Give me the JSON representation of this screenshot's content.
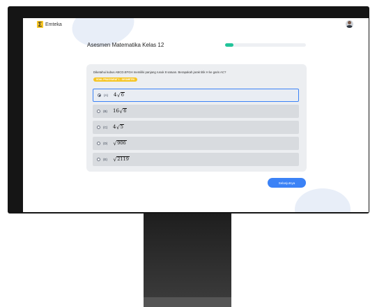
{
  "app": {
    "brand_name": "Emteka",
    "brand_mark": "Σ"
  },
  "assessment": {
    "title": "Asesmen Matematika Kelas 12",
    "progress_fraction": 0.1
  },
  "question": {
    "text": "Diketahui kubus ABCD.EFGH memiliki panjang rusuk 8 satuan. Berapakah jarak titik H ke garis AC?",
    "tag": "SOAL PRASYARAT 1 - GEOMETRI"
  },
  "options": [
    {
      "label": "(A)",
      "coef": "4",
      "radicand": "6",
      "selected": true
    },
    {
      "label": "(B)",
      "coef": "16",
      "radicand": "6",
      "selected": false
    },
    {
      "label": "(C)",
      "coef": "4",
      "radicand": "5",
      "selected": false
    },
    {
      "label": "(D)",
      "coef": "",
      "radicand": "906",
      "selected": false
    },
    {
      "label": "(E)",
      "coef": "",
      "radicand": "2119",
      "selected": false
    }
  ],
  "next_button_label": "Selanjutnya",
  "icons": {
    "avatar": "user-avatar-icon",
    "logo": "sigma-logo-icon"
  },
  "colors": {
    "accent": "#3b82f6",
    "progress": "#22c49a",
    "tag": "#f6c524"
  }
}
